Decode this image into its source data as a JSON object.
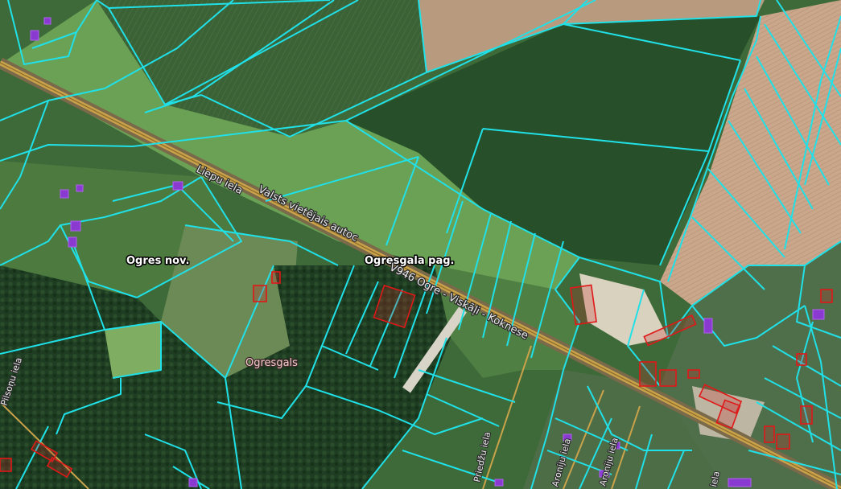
{
  "map": {
    "labels": {
      "municipality": "Ogres nov.",
      "parish": "Ogresgala pag.",
      "village": "Ogresgals"
    },
    "roads": {
      "liepu_iela": "Liepu iela",
      "state_road": "Valsts vietējais autoc",
      "state_road_2": "V946 Ogre - Viskāļi - Koknese",
      "left_street": "Pilsoņu iela",
      "priedzu_iela": "Priedžu iela",
      "aronijiela_1": "Aroniju iela",
      "aronijiela_2": "Aroniju iela",
      "right_street": "iela"
    },
    "colors": {
      "parcel_boundary": "#20e0e8",
      "building_outline": "#e01818",
      "building_fill": "#8a3ad0",
      "road": "#c9a24a"
    },
    "icons": {
      "parcel": "cadastral-parcel-boundary",
      "building": "building-footprint"
    }
  }
}
